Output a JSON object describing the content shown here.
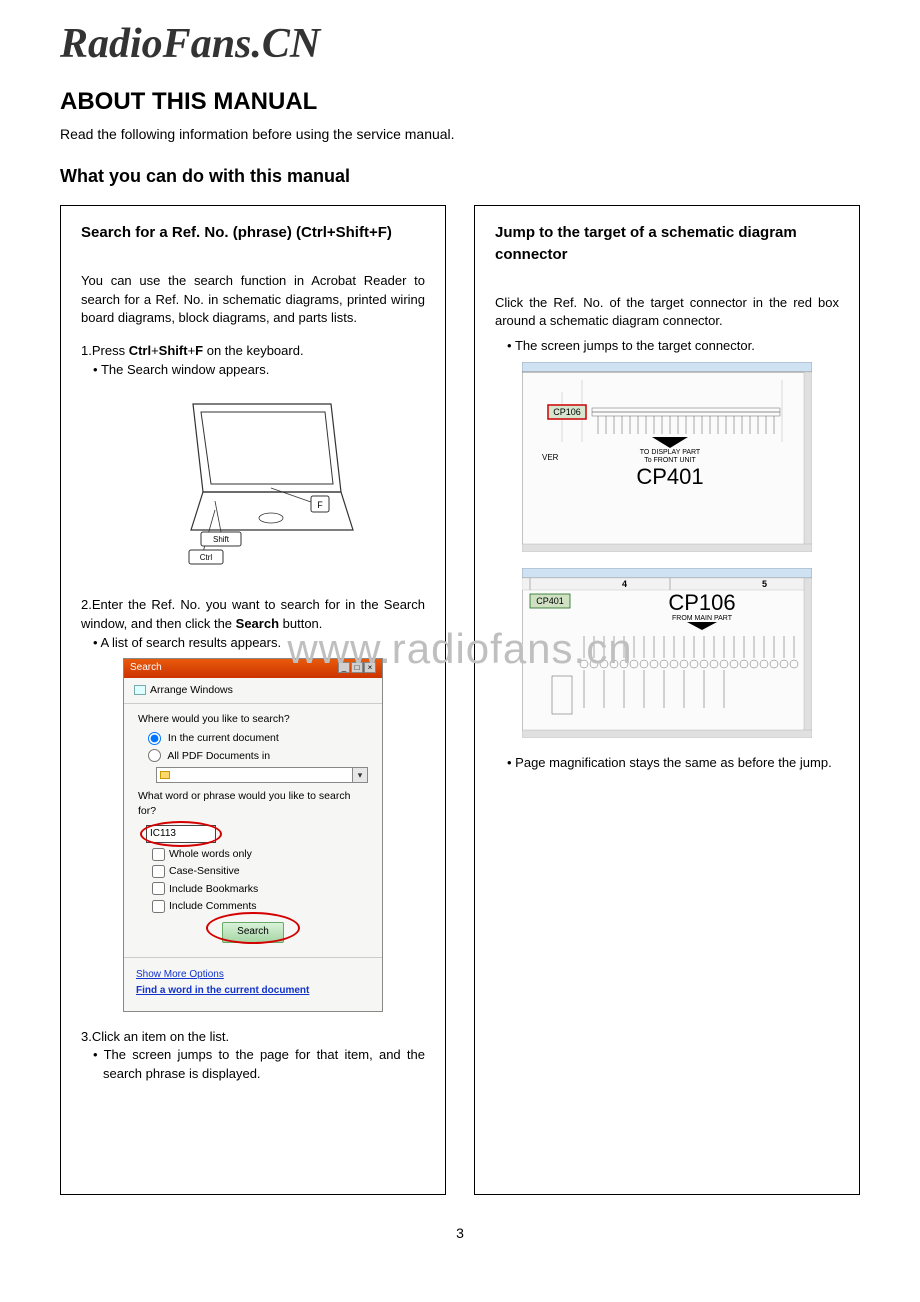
{
  "watermark_top": "RadioFans.CN",
  "watermark_mid": "www.radiofans.cn",
  "title": "ABOUT THIS MANUAL",
  "intro": "Read the following information before using the service manual.",
  "subtitle": "What you can do with this manual",
  "page_number": "3",
  "left": {
    "heading": "Search for a Ref. No. (phrase) (Ctrl+Shift+F)",
    "para1": "You can use the search function in Acrobat Reader to search for a Ref. No. in schematic diagrams, printed wiring board diagrams, block diagrams, and parts lists.",
    "step1": "1.Press Ctrl+Shift+F on the keyboard.",
    "step1_bullet": "The Search window appears.",
    "key_f": "F",
    "key_shift": "Shift",
    "key_ctrl": "Ctrl",
    "step2": "2.Enter the Ref. No. you want to search for in the Search window, and then click the Search button.",
    "step2_bullet": "A list of search results appears.",
    "search_window": {
      "title": "Search",
      "arrange": "Arrange Windows",
      "where_q": "Where would you like to search?",
      "radio_current": "In the current document",
      "radio_all": "All PDF Documents in",
      "phrase_q": "What word or phrase would you like to search for?",
      "input_value": "IC113",
      "chk_whole": "Whole words only",
      "chk_case": "Case-Sensitive",
      "chk_bookmarks": "Include Bookmarks",
      "chk_comments": "Include Comments",
      "search_btn": "Search",
      "link_more": "Show More Options",
      "link_find": "Find a word in the current document"
    },
    "step3": "3.Click an item on the list.",
    "step3_bullet": "The screen jumps to the page for that item, and the search phrase is displayed."
  },
  "right": {
    "heading": "Jump to the target of a schematic diagram connector",
    "para1": "Click the Ref. No. of the target connector in the red box around a schematic diagram connector.",
    "bullet1": "The screen jumps to the target connector.",
    "cp106_label": "CP106",
    "display_line1": "TO DISPLAY PART",
    "display_line2": "To FRONT UNIT",
    "cp401_big": "CP401",
    "ver_label": "VER",
    "fig2_num4": "4",
    "fig2_num5": "5",
    "cp401_small": "CP401",
    "cp106_big": "CP106",
    "from_main": "FROM MAIN PART",
    "bullet2": "Page magnification stays the same as before the jump."
  }
}
